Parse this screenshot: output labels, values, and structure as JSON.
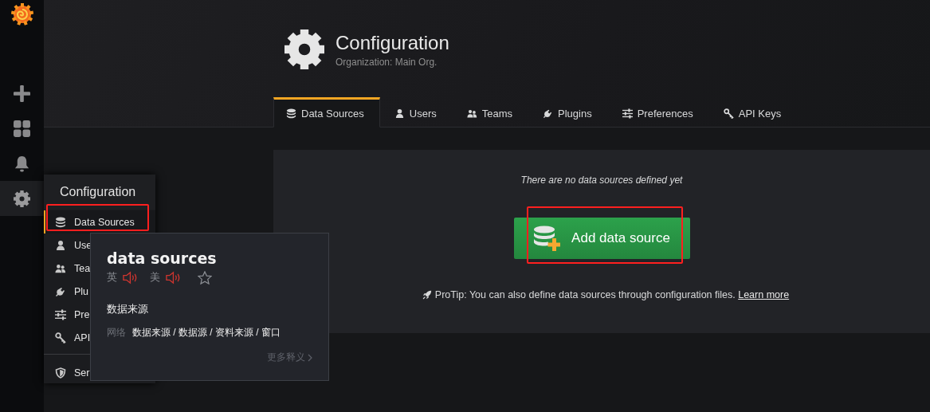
{
  "sidebar": {
    "items": [
      {
        "kind": "create",
        "selected": false
      },
      {
        "kind": "dashboards",
        "selected": false
      },
      {
        "kind": "alerting",
        "selected": false
      },
      {
        "kind": "configuration",
        "selected": true
      }
    ]
  },
  "flyout": {
    "title": "Configuration",
    "items": [
      {
        "kind": "database",
        "label": "Data Sources",
        "selected": true,
        "highlighted": true
      },
      {
        "kind": "user",
        "label": "Use",
        "selected": false,
        "highlighted": false
      },
      {
        "kind": "users",
        "label": "Tea",
        "selected": false,
        "highlighted": false
      },
      {
        "kind": "plug",
        "label": "Plu",
        "selected": false,
        "highlighted": false
      },
      {
        "kind": "sliders",
        "label": "Pre",
        "selected": false,
        "highlighted": false
      },
      {
        "kind": "key",
        "label": "API",
        "selected": false,
        "highlighted": false
      }
    ],
    "footer_items": [
      {
        "kind": "shield",
        "label": "Ser",
        "selected": false,
        "highlighted": false
      }
    ]
  },
  "header": {
    "title": "Configuration",
    "subtitle": "Organization: Main Org."
  },
  "tabs": [
    {
      "kind": "database",
      "label": "Data Sources",
      "selected": true
    },
    {
      "kind": "user",
      "label": "Users",
      "selected": false
    },
    {
      "kind": "users",
      "label": "Teams",
      "selected": false
    },
    {
      "kind": "plug",
      "label": "Plugins",
      "selected": false
    },
    {
      "kind": "sliders",
      "label": "Preferences",
      "selected": false
    },
    {
      "kind": "key",
      "label": "API Keys",
      "selected": false
    }
  ],
  "empty_state": {
    "message": "There are no data sources defined yet",
    "button": {
      "label": "Add data source",
      "highlighted": true
    },
    "protip": "ProTip: You can also define data sources through configuration files.",
    "link": "Learn more"
  },
  "popup": {
    "word": "data sources",
    "pronunciations": [
      {
        "label": "英"
      },
      {
        "label": "美"
      }
    ],
    "translation": "数据来源",
    "source_label": "网络",
    "source_text": "数据来源 / 数据源 / 资料来源 / 窗口",
    "more": "更多释义"
  }
}
